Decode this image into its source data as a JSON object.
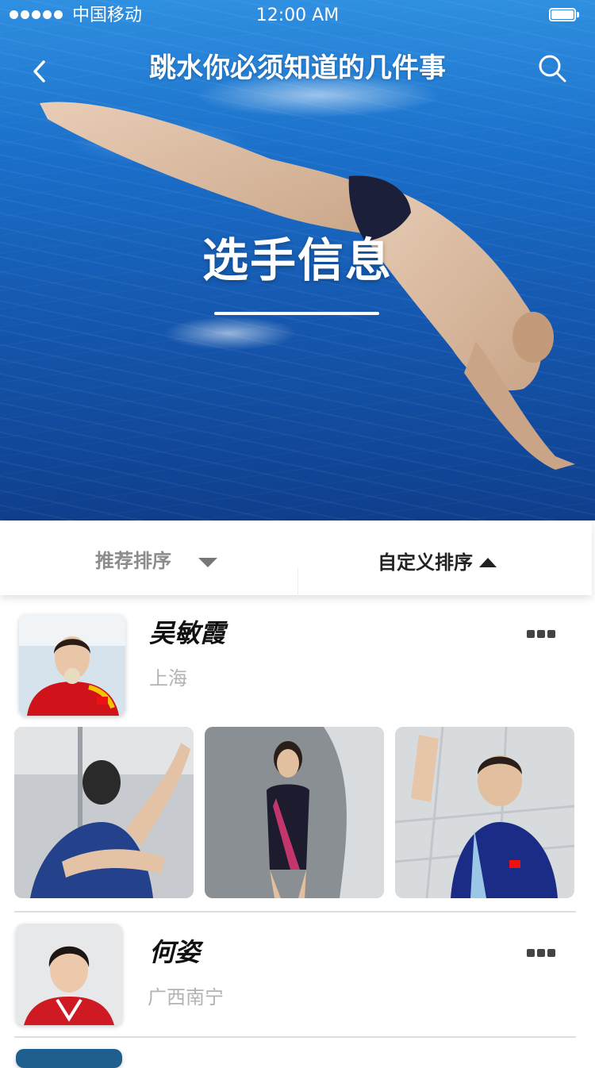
{
  "status_bar": {
    "carrier": "中国移动",
    "time": "12:00 AM"
  },
  "nav": {
    "title": "跳水你必须知道的几件事",
    "back_icon": "chevron-left-icon",
    "search_icon": "search-icon"
  },
  "hero": {
    "heading": "选手信息"
  },
  "sort": {
    "recommended_label": "推荐排序",
    "custom_label": "自定义排序"
  },
  "players": [
    {
      "name": "吴敏霞",
      "location": "上海"
    },
    {
      "name": "何姿",
      "location": "广西南宁"
    }
  ],
  "colors": {
    "water": "#1a6fc9",
    "muted_text": "#b3b3b3",
    "divider": "#dcdcdc"
  }
}
